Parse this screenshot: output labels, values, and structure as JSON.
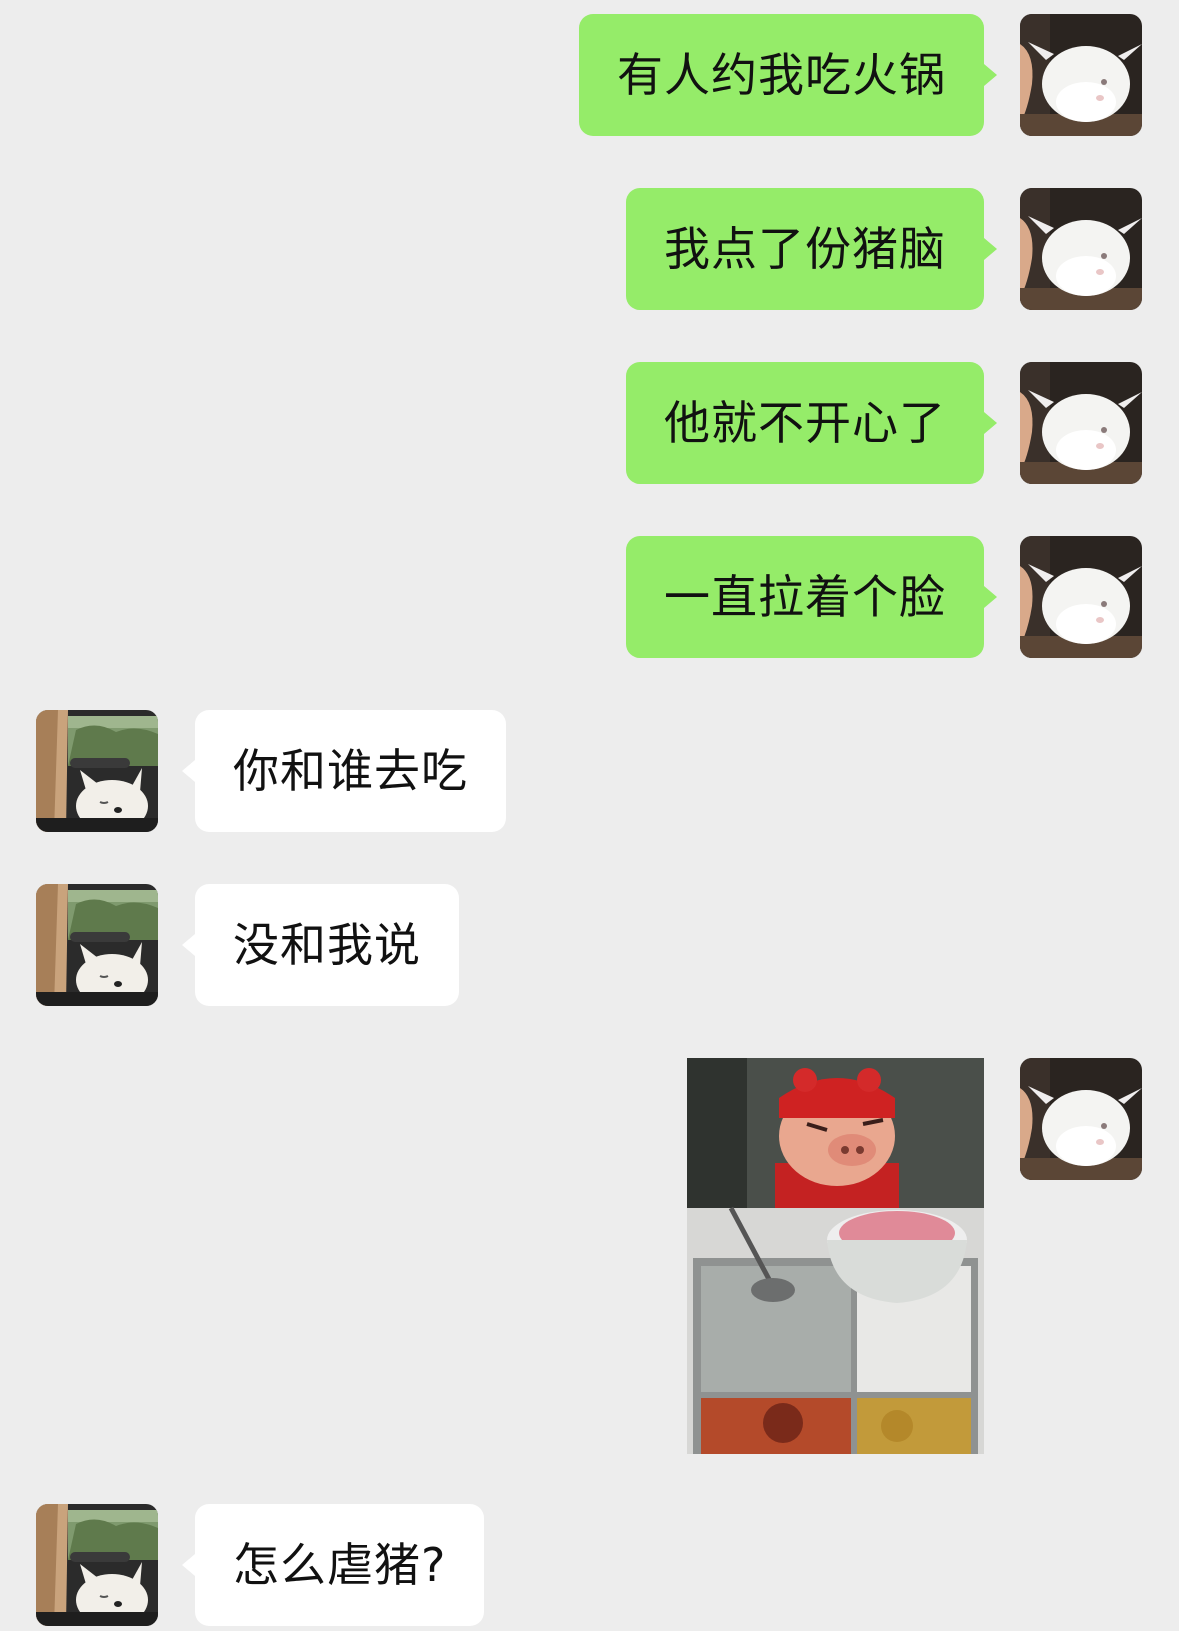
{
  "messages": [
    {
      "side": "out",
      "text": "有人约我吃火锅"
    },
    {
      "side": "out",
      "text": "我点了份猪脑"
    },
    {
      "side": "out",
      "text": "他就不开心了"
    },
    {
      "side": "out",
      "text": "一直拉着个脸"
    },
    {
      "side": "in",
      "text": "你和谁去吃"
    },
    {
      "side": "in",
      "text": "没和我说"
    },
    {
      "side": "out",
      "type": "image",
      "image": "pig-hotpot-photo"
    },
    {
      "side": "in",
      "text": "怎么虐猪?"
    }
  ],
  "colors": {
    "background": "#ededed",
    "outgoing_bubble": "#95ec69",
    "incoming_bubble": "#ffffff"
  },
  "avatars": {
    "self": "white-rabbit-avatar",
    "contact": "dog-in-car-avatar"
  }
}
